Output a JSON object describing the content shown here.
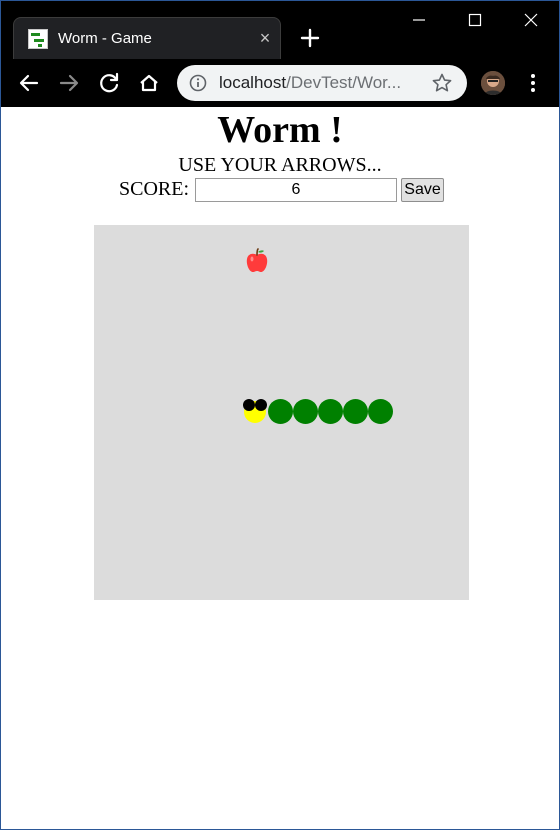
{
  "browser": {
    "tab_title": "Worm - Game",
    "tab_close_label": "×",
    "url_host": "localhost",
    "url_path": "/DevTest/Wor..."
  },
  "page": {
    "title": "Worm !",
    "instructions": "USE YOUR ARROWS...",
    "score_label": "SCORE:",
    "score_value": "6",
    "save_label": "Save"
  },
  "game": {
    "board_color": "#dcdcdc",
    "worm_body_color": "#008000",
    "worm_head_color": "#ffff00",
    "worm_eye_color": "#000000",
    "apple_color": "#ff3b3b",
    "body_segments": 5
  }
}
